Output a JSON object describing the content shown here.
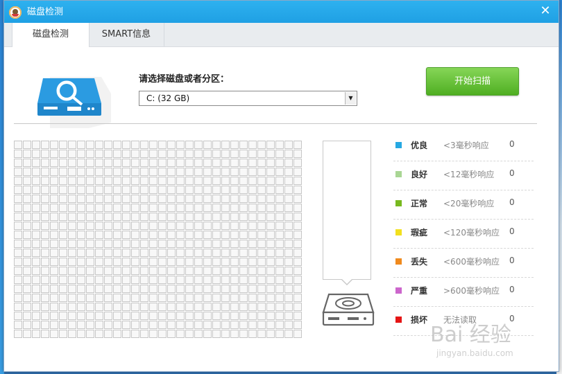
{
  "window": {
    "title": "磁盘检测",
    "close_glyph": "✕"
  },
  "tabs": [
    {
      "label": "磁盘检测",
      "active": true
    },
    {
      "label": "SMART信息",
      "active": false
    }
  ],
  "selector": {
    "label": "请选择磁盘或者分区：",
    "value": "C:  (32 GB)"
  },
  "scan_button": {
    "label": "开始扫描"
  },
  "colors": {
    "accent_title": "#21a5e8",
    "scan_button": "#5dbb2c",
    "grid_cell": "#f8f8f8",
    "grid_border": "#c6c6c6"
  },
  "legend": [
    {
      "name": "优良",
      "desc": "<3毫秒响应",
      "count": "0",
      "color": "#26a8e2"
    },
    {
      "name": "良好",
      "desc": "<12毫秒响应",
      "count": "0",
      "color": "#a9d694"
    },
    {
      "name": "正常",
      "desc": "<20毫秒响应",
      "count": "0",
      "color": "#78b91f"
    },
    {
      "name": "瑕疵",
      "desc": "<120毫秒响应",
      "count": "0",
      "color": "#f2e01e"
    },
    {
      "name": "丢失",
      "desc": "<600毫秒响应",
      "count": "0",
      "color": "#f08a1d"
    },
    {
      "name": "严重",
      "desc": ">600毫秒响应",
      "count": "0",
      "color": "#cc66cc"
    },
    {
      "name": "损坏",
      "desc": "无法读取",
      "count": "0",
      "color": "#e51515"
    }
  ],
  "block_grid": {
    "columns": 32,
    "rows": 22
  },
  "icons": {
    "disk_large": "disk-search-icon",
    "disk_small": "disk-scan-icon",
    "app_logo": "app-logo-icon"
  },
  "watermark": {
    "main": "Bai 经验",
    "cn": "经验",
    "sub": "jingyan.baidu.com"
  }
}
